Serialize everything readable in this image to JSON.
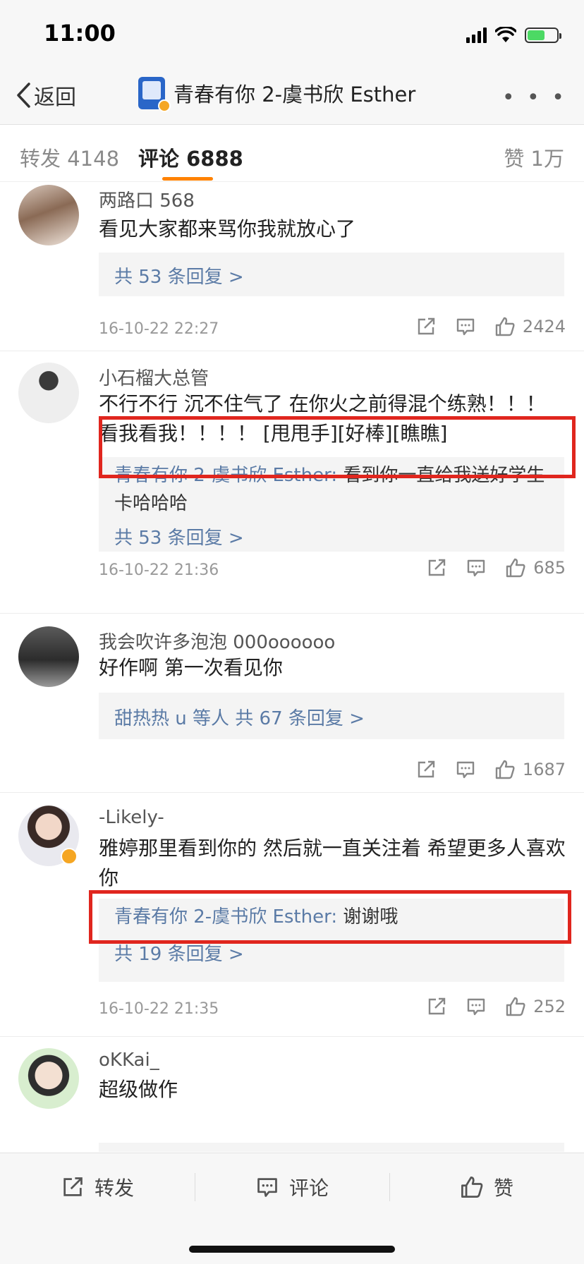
{
  "status": {
    "time": "11:00"
  },
  "nav": {
    "back_label": "返回",
    "title": "青春有你 2-虞书欣 Esther"
  },
  "tabs": [
    {
      "label": "转发",
      "count": "4148"
    },
    {
      "label": "评论",
      "count": "6888"
    },
    {
      "label": "赞",
      "count": "1万"
    }
  ],
  "comments": [
    {
      "user": "两路口 568",
      "text": "看见大家都来骂你我就放心了",
      "reply_count": "共 53 条回复 >",
      "time": "16-10-22 22:27",
      "likes": "2424"
    },
    {
      "user": "小石榴大总管",
      "text": "不行不行 沉不住气了 在你火之前得混个练熟！！！ 看我看我！！！！ [甩甩手][好棒][瞧瞧]",
      "reply_author": "青春有你 2-虞书欣 Esther:",
      "reply_text": " 看到你一直给我送好学生卡哈哈哈",
      "reply_count": "共 53 条回复 >",
      "time": "16-10-22 21:36",
      "likes": "685"
    },
    {
      "user": "我会吹许多泡泡 000oooooo",
      "text": "好作啊 第一次看见你",
      "reply_count": "甜热热 u 等人  共 67 条回复 >",
      "likes": "1687"
    },
    {
      "user": "-Likely-",
      "text": "雅婷那里看到你的 然后就一直关注着 希望更多人喜欢你",
      "reply_author": "青春有你 2-虞书欣 Esther:",
      "reply_text": " 谢谢哦",
      "reply_count": "共 19 条回复 >",
      "time": "16-10-22 21:35",
      "likes": "252"
    },
    {
      "user": "oKKai_",
      "text": "超级做作"
    }
  ],
  "bottom": {
    "repost": "转发",
    "comment": "评论",
    "like": "赞"
  },
  "colors": {
    "accent": "#ff8200",
    "link": "#5b7ba6",
    "highlight": "#e0261e"
  }
}
